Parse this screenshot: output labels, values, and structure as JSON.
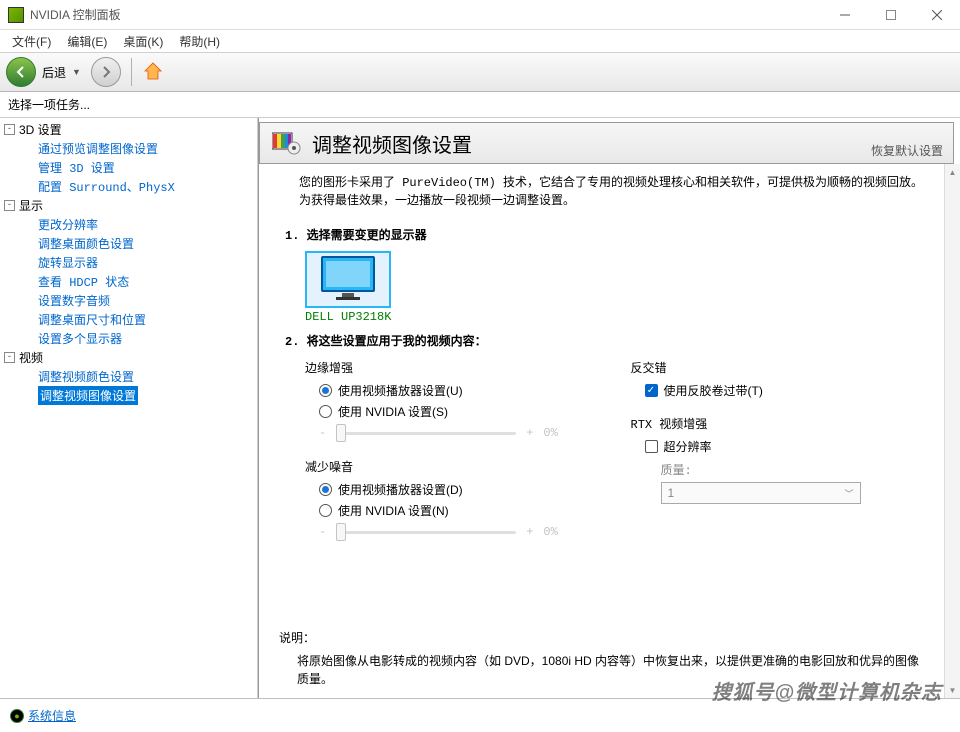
{
  "window": {
    "title": "NVIDIA 控制面板"
  },
  "menu": {
    "file": "文件(F)",
    "edit": "编辑(E)",
    "desktop": "桌面(K)",
    "help": "帮助(H)"
  },
  "toolbar": {
    "back": "后退"
  },
  "sidebar": {
    "task_label": "选择一项任务...",
    "cat_3d": "3D 设置",
    "items_3d": [
      "通过预览调整图像设置",
      "管理 3D 设置",
      "配置 Surround、PhysX"
    ],
    "cat_display": "显示",
    "items_display": [
      "更改分辨率",
      "调整桌面颜色设置",
      "旋转显示器",
      "查看 HDCP 状态",
      "设置数字音频",
      "调整桌面尺寸和位置",
      "设置多个显示器"
    ],
    "cat_video": "视频",
    "items_video": [
      "调整视频颜色设置",
      "调整视频图像设置"
    ]
  },
  "page": {
    "title": "调整视频图像设置",
    "restore": "恢复默认设置",
    "desc": "您的图形卡采用了 PureVideo(TM) 技术，它结合了专用的视频处理核心和相关软件，可提供极为顺畅的视频回放。为获得最佳效果，一边播放一段视频一边调整设置。",
    "section1": "1.  选择需要变更的显示器",
    "monitor": "DELL UP3218K",
    "section2": "2.  将这些设置应用于我的视频内容：",
    "edge": {
      "title": "边缘增强",
      "r1": "使用视频播放器设置(U)",
      "r2": "使用 NVIDIA 设置(S)",
      "val": "0%"
    },
    "noise": {
      "title": "减少噪音",
      "r1": "使用视频播放器设置(D)",
      "r2": "使用 NVIDIA 设置(N)",
      "val": "0%"
    },
    "deint": {
      "title": "反交错",
      "c1": "使用反胶卷过带(T)"
    },
    "rtx": {
      "title": "RTX 视频增强",
      "c1": "超分辨率",
      "quality_label": "质量:",
      "quality_val": "1"
    },
    "explain_h": "说明：",
    "explain_t": "将原始图像从电影转成的视频内容（如 DVD，1080i HD 内容等）中恢复出来，以提供更准确的电影回放和优异的图像质量。"
  },
  "status": {
    "sysinfo": "系统信息"
  },
  "watermark": "搜狐号@微型计算机杂志"
}
